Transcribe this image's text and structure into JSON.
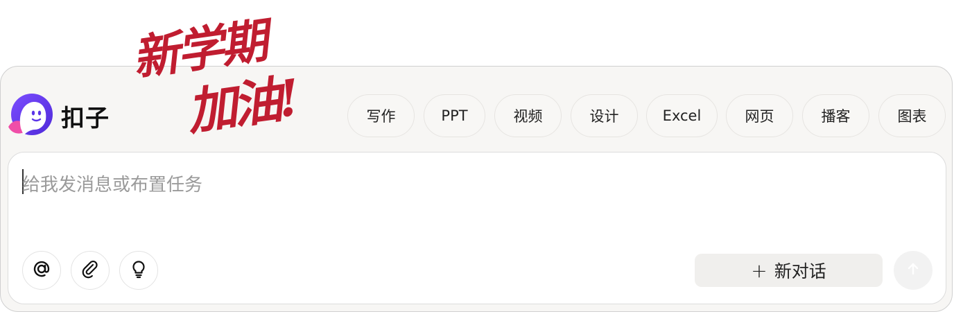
{
  "brand": {
    "name": "扣子",
    "logo_icon": "coze-ghost-logo-icon",
    "colors": {
      "purple": "#6b3cf2",
      "pink": "#f04ea8"
    }
  },
  "banner": {
    "line1": "新学期",
    "line2": "加油!",
    "color": "#c01d30"
  },
  "skills": [
    {
      "label": "写作"
    },
    {
      "label": "PPT"
    },
    {
      "label": "视频"
    },
    {
      "label": "设计"
    },
    {
      "label": "Excel"
    },
    {
      "label": "网页"
    },
    {
      "label": "播客"
    },
    {
      "label": "图表"
    }
  ],
  "composer": {
    "placeholder": "给我发消息或布置任务",
    "tools": [
      {
        "icon": "at-mention-icon"
      },
      {
        "icon": "paperclip-attach-icon"
      },
      {
        "icon": "lightbulb-icon"
      }
    ],
    "new_chat_label": "新对话",
    "new_chat_icon": "plus-icon",
    "send_icon": "arrow-up-icon"
  }
}
